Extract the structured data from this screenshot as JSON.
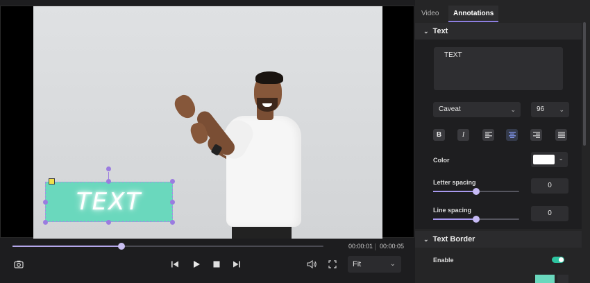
{
  "player": {
    "annotation_text": "TEXT",
    "current_time": "00:00:01",
    "total_time": "00:00:05",
    "progress": 0.35,
    "fit_label": "Fit"
  },
  "panel": {
    "tabs": [
      {
        "label": "Video",
        "active": false
      },
      {
        "label": "Annotations",
        "active": true
      }
    ],
    "text_section": {
      "title": "Text",
      "content": "TEXT",
      "font": "Caveat",
      "size": "96",
      "color_label": "Color",
      "color_value": "#ffffff",
      "letter_spacing_label": "Letter spacing",
      "letter_spacing_value": "0",
      "letter_spacing_level": 0.5,
      "line_spacing_label": "Line spacing",
      "line_spacing_value": "0",
      "line_spacing_level": 0.5
    },
    "border_section": {
      "title": "Text Border",
      "enable_label": "Enable",
      "enabled": true
    }
  },
  "colors": {
    "accent": "#8d7ee0",
    "annotation_fill": "#6ad8bd",
    "toggle_on": "#2ec4a0"
  }
}
